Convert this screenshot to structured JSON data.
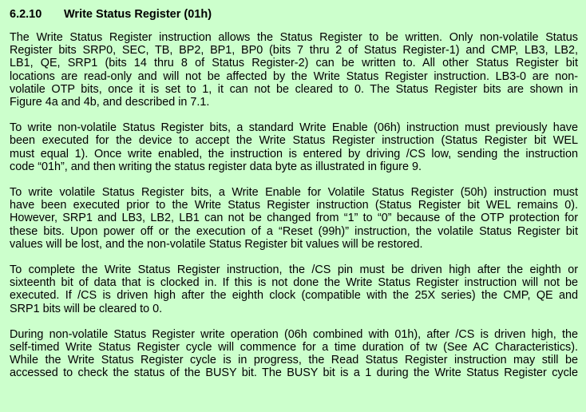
{
  "section": {
    "number": "6.2.10",
    "title": "Write Status Register (01h)"
  },
  "paragraphs": [
    {
      "lines": [
        "The Write Status Register instruction allows the Status Register to be written. Only non-volatile Status",
        "Register bits SRP0, SEC, TB, BP2, BP1, BP0 (bits 7 thru 2 of Status Register-1) and CMP, LB3, LB2,",
        "LB1, QE, SRP1 (bits 14 thru 8 of Status Register-2) can be written to. All other Status Register bit",
        "locations are read-only and will not be affected by the Write Status Register instruction. LB3-0 are non-",
        "volatile OTP bits, once it is set to 1, it can not be cleared to 0. The Status Register bits are shown in",
        "Figure 4a and 4b, and described in 7.1."
      ]
    },
    {
      "lines": [
        "To write non-volatile Status Register bits, a standard Write Enable (06h) instruction must previously have",
        "been executed for the device to accept the Write Status Register instruction (Status Register bit WEL",
        "must equal 1). Once write enabled, the instruction is entered by driving /CS low, sending the instruction",
        "code “01h”, and then writing the status register data byte as illustrated in figure 9."
      ]
    },
    {
      "lines": [
        "To write volatile Status Register bits, a Write Enable for Volatile Status Register (50h) instruction must",
        "have been executed prior to the Write Status Register instruction (Status Register bit WEL remains 0).",
        "However, SRP1 and LB3, LB2, LB1 can not be changed from “1” to “0” because of the OTP protection for",
        "these bits. Upon power off or the execution of a “Reset (99h)” instruction, the volatile Status Register bit",
        "values will be lost, and the non-volatile Status Register bit values will be restored."
      ]
    },
    {
      "lines": [
        "To complete the Write Status Register instruction, the /CS pin must be driven high after the eighth or",
        "sixteenth bit of data that is clocked in. If this is not done the Write Status Register instruction will not be",
        "executed. If /CS is driven high after the eighth clock (compatible with the 25X series) the CMP, QE and",
        "SRP1 bits will be cleared to 0."
      ]
    },
    {
      "lines": [
        "During non-volatile Status Register write operation (06h combined with 01h), after /CS is driven high, the",
        "self-timed Write Status Register cycle will commence for a time duration of tw (See AC Characteristics).",
        "While the Write Status Register cycle is in progress, the Read Status Register instruction may still be",
        "accessed to check the status of the BUSY bit. The BUSY bit is a 1 during the Write Status Register cycle"
      ],
      "truncated": true
    }
  ]
}
